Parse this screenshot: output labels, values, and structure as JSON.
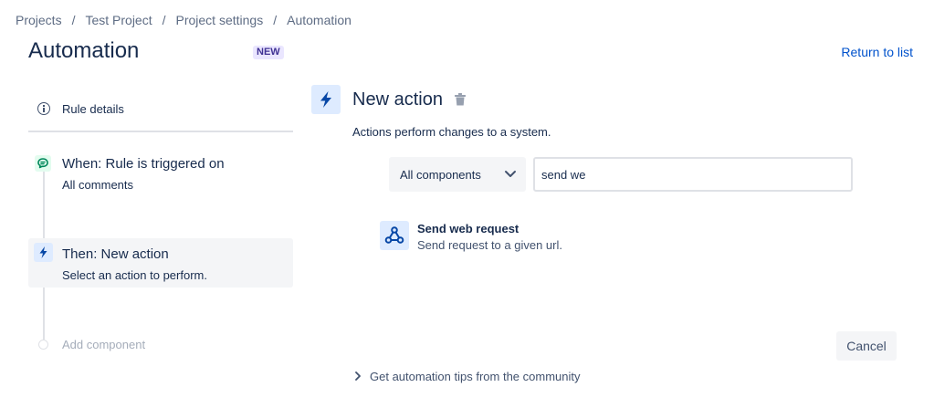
{
  "breadcrumbs": [
    "Projects",
    "Test Project",
    "Project settings",
    "Automation"
  ],
  "breadcrumb_separator": "/",
  "header": {
    "title": "Automation",
    "badge": "NEW",
    "return_link": "Return to list"
  },
  "sidebar": {
    "rule_details": "Rule details",
    "trigger": {
      "title": "When: Rule is triggered on",
      "subtitle": "All comments",
      "icon": "comment-icon"
    },
    "action": {
      "title": "Then: New action",
      "subtitle": "Select an action to perform.",
      "icon": "lightning-icon"
    },
    "add_component": "Add component"
  },
  "panel": {
    "title": "New action",
    "description": "Actions perform changes to a system.",
    "filter_select": {
      "value": "All components"
    },
    "search": {
      "value": "send we"
    },
    "results": [
      {
        "title": "Send web request",
        "subtitle": "Send request to a given url.",
        "icon": "webhook-icon"
      }
    ],
    "cancel_label": "Cancel",
    "tips_link": "Get automation tips from the community"
  },
  "colors": {
    "primary_link": "#0052cc",
    "text": "#172b4d",
    "subtle_bg": "#f4f5f7",
    "action_bg": "#deebff",
    "trigger_bg": "#e3fcef",
    "badge_bg": "#eae6ff"
  }
}
